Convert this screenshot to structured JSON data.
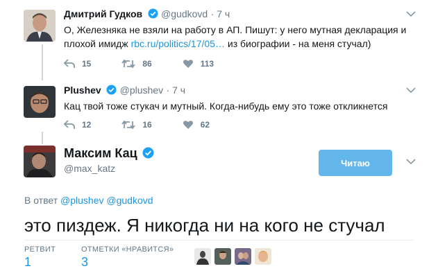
{
  "tweet1": {
    "name": "Дмитрий Гудков",
    "handle": "@gudkovd",
    "time": "· 7 ч",
    "text_before": "О, Железняка не взяли на работу в АП. Пишут: у него мутная декларация и плохой имидж ",
    "link": "rbc.ru/politics/17/05…",
    "text_after": " из биографии - на меня стучал)",
    "replies": "15",
    "retweets": "86",
    "likes": "113"
  },
  "tweet2": {
    "name": "Plushev",
    "handle": "@plushev",
    "time": "· 7 ч",
    "text": "Кац твой тоже стукач и мутный. Когда-нибудь ему это тоже откликнется",
    "replies": "12",
    "retweets": "16",
    "likes": "62"
  },
  "main": {
    "name": "Максим Кац",
    "handle": "@max_katz",
    "follow_label": "Читаю",
    "reply_prefix": "В ответ",
    "reply_to_1": "@plushev",
    "reply_to_2": "@gudkovd",
    "text": "это пиздеж. Я никогда ни на кого не стучал",
    "retweets_label": "РЕТВИТ",
    "retweets_count": "1",
    "likes_label": "ОТМЕТКИ «НРАВИТСЯ»",
    "likes_count": "3"
  },
  "colors": {
    "link": "#1b95e0",
    "muted": "#657786",
    "verified": "#1da1f2",
    "follow_button": "#63b6e9",
    "thread_line": "#ccd6dd"
  }
}
